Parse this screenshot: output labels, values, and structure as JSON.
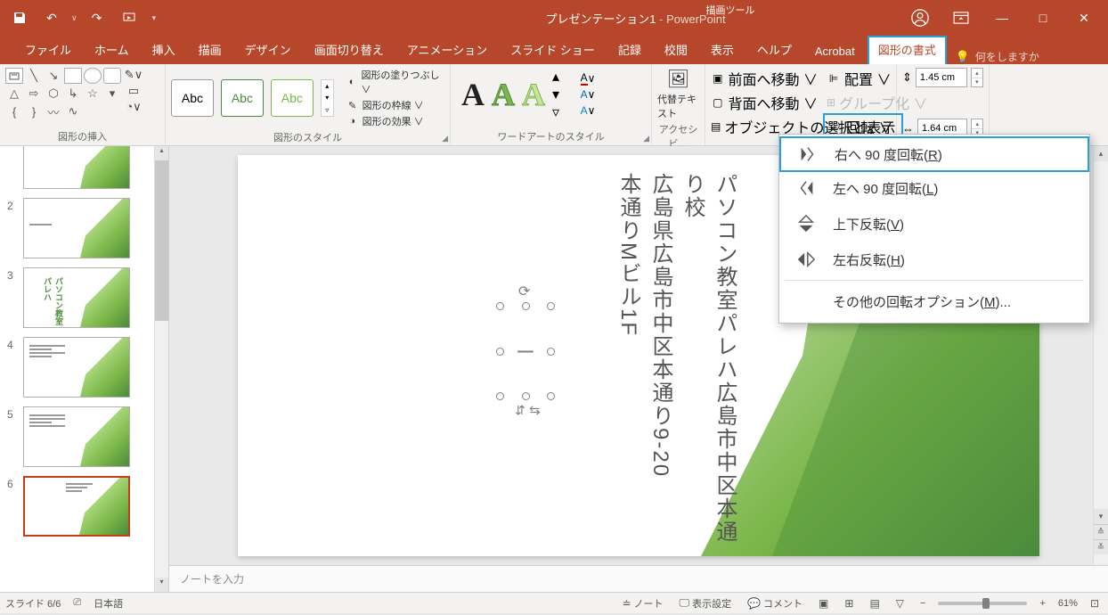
{
  "titlebar": {
    "doc_name": "プレゼンテーション1",
    "app_name": " - PowerPoint",
    "tool_context": "描画ツール"
  },
  "tabs": {
    "file": "ファイル",
    "home": "ホーム",
    "insert": "挿入",
    "draw": "描画",
    "design": "デザイン",
    "transitions": "画面切り替え",
    "animations": "アニメーション",
    "slideshow": "スライド ショー",
    "record": "記録",
    "review": "校閲",
    "view": "表示",
    "help": "ヘルプ",
    "acrobat": "Acrobat",
    "format": "図形の書式",
    "tell_me": "何をしますか"
  },
  "ribbon": {
    "insert_shapes_label": "図形の挿入",
    "shape_styles_label": "図形のスタイル",
    "wordart_label": "ワードアートのスタイル",
    "accessibility_label": "アクセシビ…",
    "style_swatch": "Abc",
    "shape_fill": "図形の塗りつぶし ∨",
    "shape_outline": "図形の枠線 ∨",
    "shape_effects": "図形の効果 ∨",
    "alt_text": "代替テキスト",
    "bring_forward": "前面へ移動  ∨",
    "send_backward": "背面へ移動  ∨",
    "selection_pane": "オブジェクトの選択と表示",
    "align": "配置 ∨",
    "group": "グループ化 ∨",
    "rotate": "回転 ∨",
    "height": "1.45 cm",
    "width": "1.64 cm"
  },
  "rotate_menu": {
    "r90_pre": "右へ 90 度回転(",
    "r90_key": "R",
    "r90_post": ")",
    "l90_pre": "左へ 90 度回転(",
    "l90_key": "L",
    "l90_post": ")",
    "flipv_pre": "上下反転(",
    "flipv_key": "V",
    "flipv_post": ")",
    "fliph_pre": "左右反転(",
    "fliph_key": "H",
    "fliph_post": ")",
    "more_pre": "その他の回転オプション(",
    "more_key": "M",
    "more_post": ")..."
  },
  "slide_content": {
    "line1": "パソコン教室パレハ広島市中区本通り校",
    "line2": "広島県広島市中区本通り9‐20",
    "line3": "本通りMビル1F",
    "shape_char": "ー"
  },
  "thumbs": {
    "s3_text": "パソコン教室パレハ"
  },
  "notes": {
    "placeholder": "ノートを入力"
  },
  "status": {
    "slide_counter": "スライド 6/6",
    "language": "日本語",
    "notes_btn": "ノート",
    "display_settings": "表示設定",
    "comments": "コメント",
    "zoom": "61%"
  }
}
